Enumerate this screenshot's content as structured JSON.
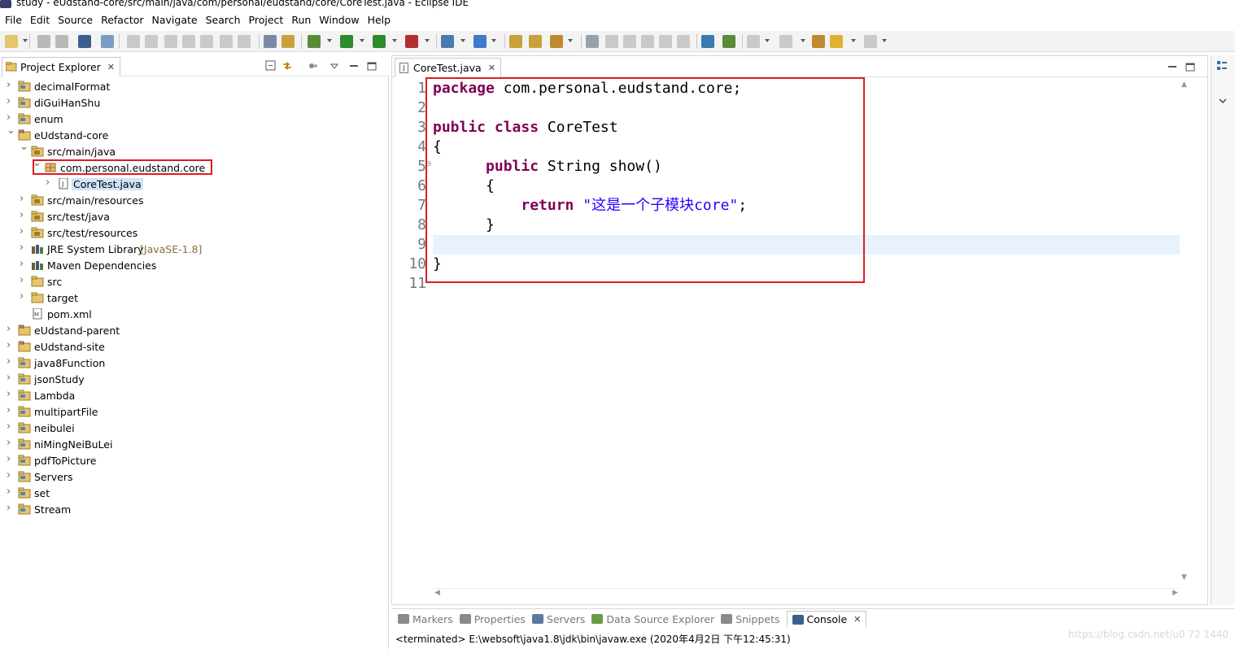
{
  "window": {
    "title": "study - eUdstand-core/src/main/java/com/personal/eudstand/core/CoreTest.java - Eclipse IDE"
  },
  "menu": [
    "File",
    "Edit",
    "Source",
    "Refactor",
    "Navigate",
    "Search",
    "Project",
    "Run",
    "Window",
    "Help"
  ],
  "project_explorer": {
    "tab_label": "Project Explorer",
    "items": [
      {
        "label": "decimalFormat",
        "indent": 0,
        "expanded": false,
        "icon": "project-icon"
      },
      {
        "label": "diGuiHanShu",
        "indent": 0,
        "expanded": false,
        "icon": "project-icon"
      },
      {
        "label": "enum",
        "indent": 0,
        "expanded": false,
        "icon": "project-icon"
      },
      {
        "label": "eUdstand-core",
        "indent": 0,
        "expanded": true,
        "icon": "maven-project-icon"
      },
      {
        "label": "src/main/java",
        "indent": 1,
        "expanded": true,
        "icon": "source-folder-icon"
      },
      {
        "label": "com.personal.eudstand.core",
        "indent": 2,
        "expanded": true,
        "icon": "package-icon"
      },
      {
        "label": "CoreTest.java",
        "indent": 3,
        "expanded": false,
        "icon": "java-file-icon"
      },
      {
        "label": "src/main/resources",
        "indent": 1,
        "expanded": false,
        "icon": "source-folder-icon"
      },
      {
        "label": "src/test/java",
        "indent": 1,
        "expanded": false,
        "icon": "source-folder-icon"
      },
      {
        "label": "src/test/resources",
        "indent": 1,
        "expanded": false,
        "icon": "source-folder-icon"
      },
      {
        "label": "JRE System Library",
        "decoration": "[JavaSE-1.8]",
        "indent": 1,
        "expanded": false,
        "icon": "library-icon"
      },
      {
        "label": "Maven Dependencies",
        "indent": 1,
        "expanded": false,
        "icon": "library-icon"
      },
      {
        "label": "src",
        "indent": 1,
        "expanded": false,
        "icon": "folder-icon"
      },
      {
        "label": "target",
        "indent": 1,
        "expanded": false,
        "icon": "folder-icon"
      },
      {
        "label": "pom.xml",
        "indent": 1,
        "expanded": false,
        "icon": "xml-file-icon"
      },
      {
        "label": "eUdstand-parent",
        "indent": 0,
        "expanded": false,
        "icon": "maven-project-icon"
      },
      {
        "label": "eUdstand-site",
        "indent": 0,
        "expanded": false,
        "icon": "maven-project-icon"
      },
      {
        "label": "java8Function",
        "indent": 0,
        "expanded": false,
        "icon": "project-icon"
      },
      {
        "label": "jsonStudy",
        "indent": 0,
        "expanded": false,
        "icon": "project-icon"
      },
      {
        "label": "Lambda",
        "indent": 0,
        "expanded": false,
        "icon": "project-icon"
      },
      {
        "label": "multipartFile",
        "indent": 0,
        "expanded": false,
        "icon": "project-icon"
      },
      {
        "label": "neibulei",
        "indent": 0,
        "expanded": false,
        "icon": "project-icon"
      },
      {
        "label": "niMingNeiBuLei",
        "indent": 0,
        "expanded": false,
        "icon": "project-icon"
      },
      {
        "label": "pdfToPicture",
        "indent": 0,
        "expanded": false,
        "icon": "project-icon"
      },
      {
        "label": "Servers",
        "indent": 0,
        "expanded": false,
        "icon": "project-icon"
      },
      {
        "label": "set",
        "indent": 0,
        "expanded": false,
        "icon": "project-icon"
      },
      {
        "label": "Stream",
        "indent": 0,
        "expanded": false,
        "icon": "project-icon"
      }
    ]
  },
  "editor": {
    "tab_label": "CoreTest.java",
    "line_numbers": [
      "1",
      "2",
      "3",
      "4",
      "5",
      "6",
      "7",
      "8",
      "9",
      "10",
      "11"
    ],
    "lines": [
      [
        {
          "t": "package",
          "k": "kw"
        },
        {
          "t": " com.personal.eudstand.core;",
          "k": ""
        }
      ],
      [],
      [
        {
          "t": "public",
          "k": "kw"
        },
        {
          "t": " ",
          "k": ""
        },
        {
          "t": "class",
          "k": "kw"
        },
        {
          "t": " CoreTest",
          "k": ""
        }
      ],
      [
        {
          "t": "{",
          "k": ""
        }
      ],
      [
        {
          "t": "      ",
          "k": ""
        },
        {
          "t": "public",
          "k": "kw"
        },
        {
          "t": " String show()",
          "k": ""
        }
      ],
      [
        {
          "t": "      {",
          "k": ""
        }
      ],
      [
        {
          "t": "          ",
          "k": ""
        },
        {
          "t": "return",
          "k": "kw"
        },
        {
          "t": " ",
          "k": ""
        },
        {
          "t": "\"这是一个子模块core\"",
          "k": "str"
        },
        {
          "t": ";",
          "k": ""
        }
      ],
      [
        {
          "t": "      }",
          "k": ""
        }
      ],
      [],
      [
        {
          "t": "}",
          "k": ""
        }
      ],
      []
    ]
  },
  "console": {
    "tabs": [
      {
        "label": "Markers",
        "icon": "markers-icon",
        "active": false
      },
      {
        "label": "Properties",
        "icon": "properties-icon",
        "active": false
      },
      {
        "label": "Servers",
        "icon": "servers-icon",
        "active": false
      },
      {
        "label": "Data Source Explorer",
        "icon": "data-source-icon",
        "active": false
      },
      {
        "label": "Snippets",
        "icon": "snippets-icon",
        "active": false
      },
      {
        "label": "Console",
        "icon": "console-icon",
        "active": true
      }
    ],
    "status_line": "<terminated> E:\\websoft\\java1.8\\jdk\\bin\\javaw.exe (2020年4月2日 下午12:45:31)",
    "watermark": "https://blog.csdn.net/u0 72 1440"
  },
  "colors": {
    "keyword": "#7f0055",
    "string": "#2a00ff",
    "highlight_box": "#e01b24",
    "current_line": "#e8f2fe"
  }
}
